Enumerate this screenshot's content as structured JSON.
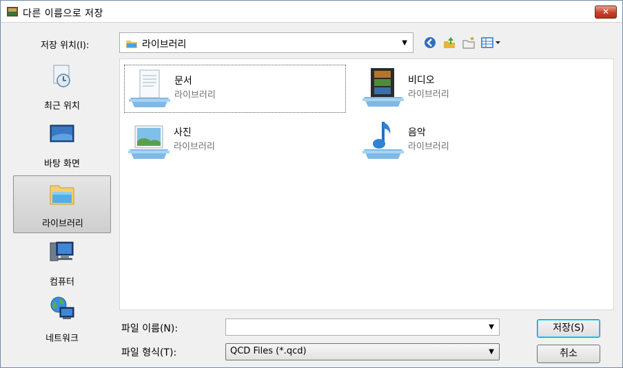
{
  "window": {
    "title": "다른 이름으로 저장",
    "close_glyph": "✕"
  },
  "location": {
    "label": "저장 위치(I):",
    "value": "라이브러리",
    "toolbar": [
      "back-icon",
      "up-folder-icon",
      "new-folder-icon",
      "views-menu-icon"
    ]
  },
  "places": [
    {
      "label": "최근 위치",
      "icon": "recent-places-icon"
    },
    {
      "label": "바탕 화면",
      "icon": "desktop-icon"
    },
    {
      "label": "라이브러리",
      "icon": "libraries-icon",
      "selected": true
    },
    {
      "label": "컴퓨터",
      "icon": "computer-icon"
    },
    {
      "label": "네트워크",
      "icon": "network-icon"
    }
  ],
  "libraries": [
    {
      "name": "문서",
      "type": "라이브러리",
      "icon": "documents-library-icon"
    },
    {
      "name": "비디오",
      "type": "라이브러리",
      "icon": "videos-library-icon"
    },
    {
      "name": "사진",
      "type": "라이브러리",
      "icon": "pictures-library-icon"
    },
    {
      "name": "음악",
      "type": "라이브러리",
      "icon": "music-library-icon"
    }
  ],
  "filename": {
    "label": "파일 이름(N):",
    "value": ""
  },
  "filetype": {
    "label": "파일 형식(T):",
    "value": "QCD Files (*.qcd)"
  },
  "buttons": {
    "save": "저장(S)",
    "cancel": "취소"
  },
  "colors": {
    "accent": "#3c7fb1",
    "close": "#c4412b",
    "secondary_text": "#6d6d6d"
  }
}
